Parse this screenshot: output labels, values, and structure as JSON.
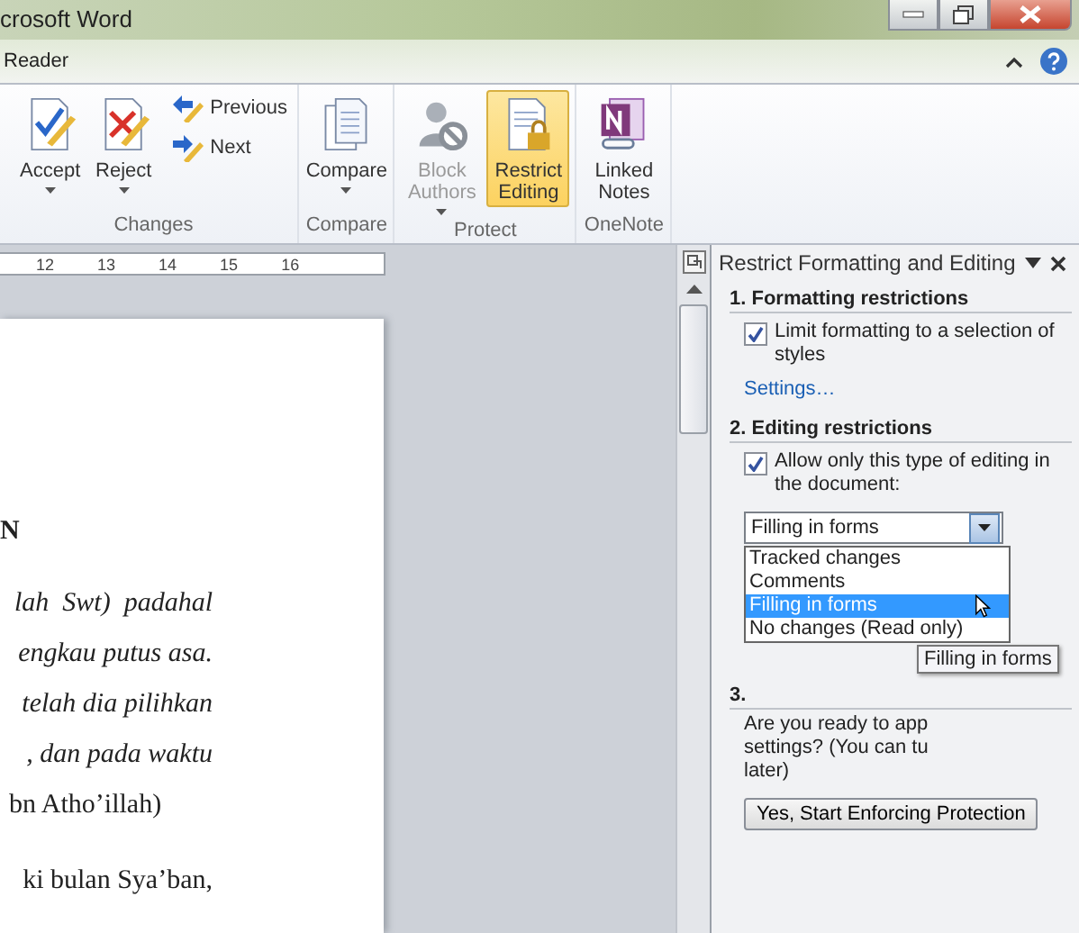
{
  "window": {
    "title": "crosoft Word"
  },
  "ribbon_tab": {
    "label": "Reader"
  },
  "ribbon_groups": [
    {
      "label": "Changes",
      "buttons": [
        {
          "kind": "accept",
          "label": "Accept",
          "dropdown": true,
          "disabled": false,
          "selected": false
        },
        {
          "kind": "reject",
          "label": "Reject",
          "dropdown": true,
          "disabled": false,
          "selected": false
        },
        {
          "kind": "previous",
          "label": "Previous",
          "disabled": false,
          "selected": false
        },
        {
          "kind": "next",
          "label": "Next",
          "disabled": false,
          "selected": false
        }
      ]
    },
    {
      "label": "Compare",
      "buttons": [
        {
          "kind": "compare",
          "label": "Compare",
          "dropdown": true,
          "disabled": false,
          "selected": false
        }
      ]
    },
    {
      "label": "Protect",
      "buttons": [
        {
          "kind": "block",
          "label": "Block Authors",
          "dropdown": true,
          "disabled": true,
          "selected": false
        },
        {
          "kind": "restrict",
          "label": "Restrict Editing",
          "dropdown": false,
          "disabled": false,
          "selected": true
        }
      ]
    },
    {
      "label": "OneNote",
      "buttons": [
        {
          "kind": "onenote",
          "label": "Linked Notes",
          "dropdown": false,
          "disabled": false,
          "selected": false
        }
      ]
    }
  ],
  "ruler": {
    "numbers": [
      "12",
      "13",
      "14",
      "15",
      "16"
    ]
  },
  "document": {
    "lines": [
      {
        "kind": "heading",
        "text": "N"
      },
      {
        "kind": "italic",
        "text": "lah  Swt)  padahal"
      },
      {
        "kind": "italic",
        "text": "engkau putus asa."
      },
      {
        "kind": "italic",
        "text": "telah dia pilihkan"
      },
      {
        "kind": "italic",
        "text": ", dan pada waktu"
      },
      {
        "kind": "normal",
        "text": "bn Atho’illah)"
      },
      {
        "kind": "gap",
        "text": "ki bulan Sya’ban,"
      }
    ]
  },
  "task_pane": {
    "title": "Restrict Formatting and Editing",
    "section_1": {
      "heading": "1. Formatting restrictions",
      "checkbox": {
        "label": "Limit formatting to a selection of styles",
        "checked": true
      },
      "link": "Settings…"
    },
    "section_2": {
      "heading": "2. Editing restrictions",
      "checkbox": {
        "label": "Allow only this type of editing in the document:",
        "checked": true
      },
      "dropdown": {
        "value": "Filling in forms",
        "options": [
          {
            "label": "Tracked changes",
            "selected": false
          },
          {
            "label": "Comments",
            "selected": false
          },
          {
            "label": "Filling in forms",
            "selected": true
          },
          {
            "label": "No changes (Read only)",
            "selected": false
          }
        ]
      }
    },
    "section_3": {
      "heading": "3.",
      "lines": [
        "Are you ready to app",
        "settings? (You can tu",
        "later)"
      ],
      "button": "Yes, Start Enforcing Protection"
    },
    "tooltip": "Filling in forms"
  }
}
